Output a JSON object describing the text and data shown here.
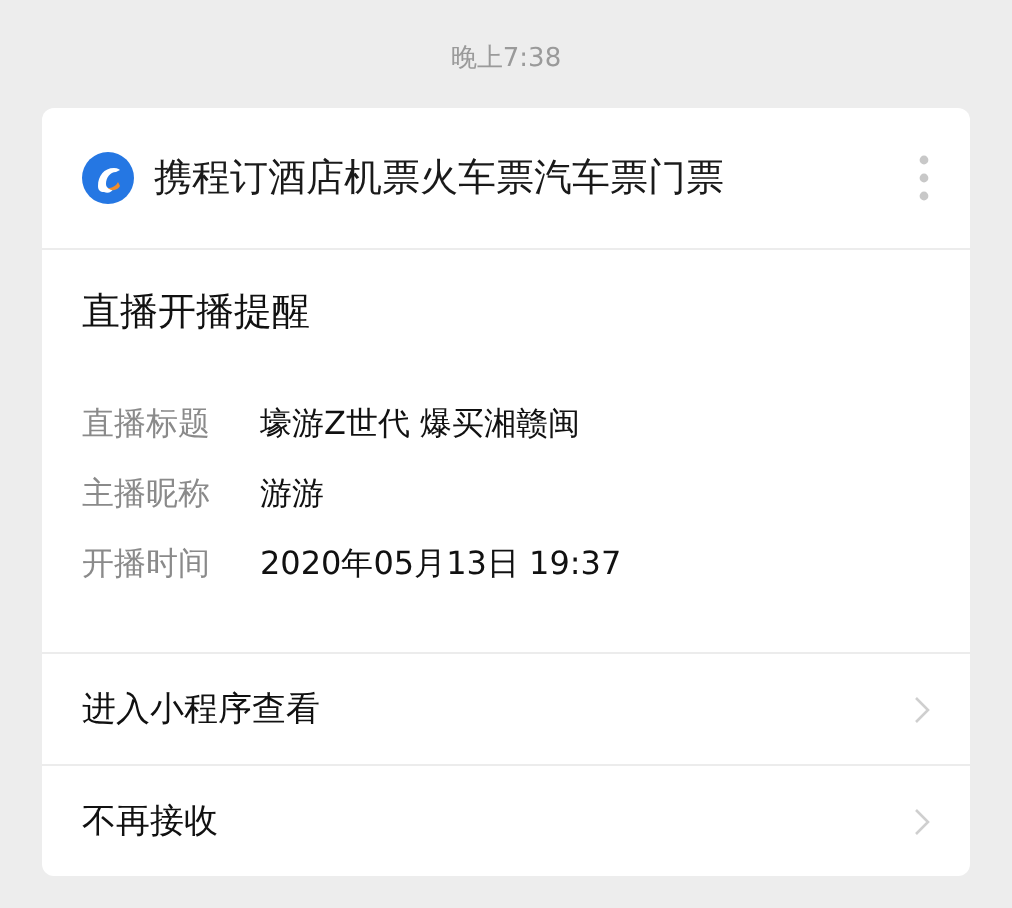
{
  "timestamp": "晚上7:38",
  "card": {
    "app_name": "携程订酒店机票火车票汽车票门票",
    "title": "直播开播提醒",
    "fields": [
      {
        "label": "直播标题",
        "value": "壕游Z世代 爆买湘赣闽"
      },
      {
        "label": "主播昵称",
        "value": "游游"
      },
      {
        "label": "开播时间",
        "value": "2020年05月13日 19:37"
      }
    ],
    "actions": [
      "进入小程序查看",
      "不再接收"
    ]
  }
}
